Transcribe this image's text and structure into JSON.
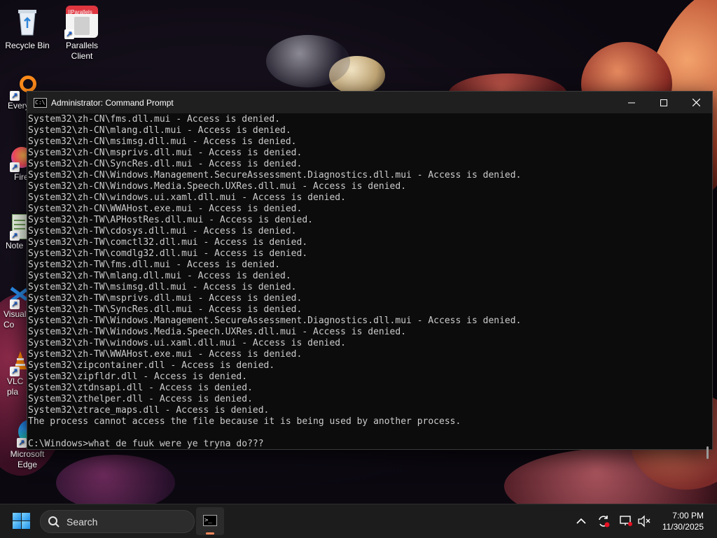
{
  "desktop": {
    "icons": [
      {
        "label": "Recycle Bin",
        "icon": "recycle-bin-icon"
      },
      {
        "label": "Parallels\nClient",
        "icon": "parallels-client-icon",
        "badge": "||Parallels"
      },
      {
        "label": "Every",
        "icon": "everything-icon"
      },
      {
        "label": "Fire",
        "icon": "firefox-icon"
      },
      {
        "label": "Note",
        "icon": "notepad-icon"
      },
      {
        "label": "Visual\nCo",
        "icon": "vscode-icon"
      },
      {
        "label": "VLC \npla",
        "icon": "vlc-icon"
      },
      {
        "label": "Microsoft\nEdge",
        "icon": "edge-icon"
      }
    ]
  },
  "window": {
    "title": "Administrator: Command Prompt",
    "controls": {
      "minimize": "minimize-icon",
      "maximize": "maximize-icon",
      "close": "close-icon"
    },
    "console_lines": [
      "System32\\zh-CN\\fms.dll.mui - Access is denied.",
      "System32\\zh-CN\\mlang.dll.mui - Access is denied.",
      "System32\\zh-CN\\msimsg.dll.mui - Access is denied.",
      "System32\\zh-CN\\msprivs.dll.mui - Access is denied.",
      "System32\\zh-CN\\SyncRes.dll.mui - Access is denied.",
      "System32\\zh-CN\\Windows.Management.SecureAssessment.Diagnostics.dll.mui - Access is denied.",
      "System32\\zh-CN\\Windows.Media.Speech.UXRes.dll.mui - Access is denied.",
      "System32\\zh-CN\\windows.ui.xaml.dll.mui - Access is denied.",
      "System32\\zh-CN\\WWAHost.exe.mui - Access is denied.",
      "System32\\zh-TW\\APHostRes.dll.mui - Access is denied.",
      "System32\\zh-TW\\cdosys.dll.mui - Access is denied.",
      "System32\\zh-TW\\comctl32.dll.mui - Access is denied.",
      "System32\\zh-TW\\comdlg32.dll.mui - Access is denied.",
      "System32\\zh-TW\\fms.dll.mui - Access is denied.",
      "System32\\zh-TW\\mlang.dll.mui - Access is denied.",
      "System32\\zh-TW\\msimsg.dll.mui - Access is denied.",
      "System32\\zh-TW\\msprivs.dll.mui - Access is denied.",
      "System32\\zh-TW\\SyncRes.dll.mui - Access is denied.",
      "System32\\zh-TW\\Windows.Management.SecureAssessment.Diagnostics.dll.mui - Access is denied.",
      "System32\\zh-TW\\Windows.Media.Speech.UXRes.dll.mui - Access is denied.",
      "System32\\zh-TW\\windows.ui.xaml.dll.mui - Access is denied.",
      "System32\\zh-TW\\WWAHost.exe.mui - Access is denied.",
      "System32\\zipcontainer.dll - Access is denied.",
      "System32\\zipfldr.dll - Access is denied.",
      "System32\\ztdnsapi.dll - Access is denied.",
      "System32\\zthelper.dll - Access is denied.",
      "System32\\ztrace_maps.dll - Access is denied.",
      "The process cannot access the file because it is being used by another process.",
      "",
      "C:\\Windows>what de fuuk were ye tryna do???"
    ]
  },
  "taskbar": {
    "search_placeholder": "Search",
    "time": "7:00 PM",
    "date": "11/30/2025",
    "tray_icons": [
      "chevron-up-icon",
      "sync-icon",
      "network-icon",
      "volume-muted-icon"
    ],
    "accent": "#ff8a5c"
  }
}
